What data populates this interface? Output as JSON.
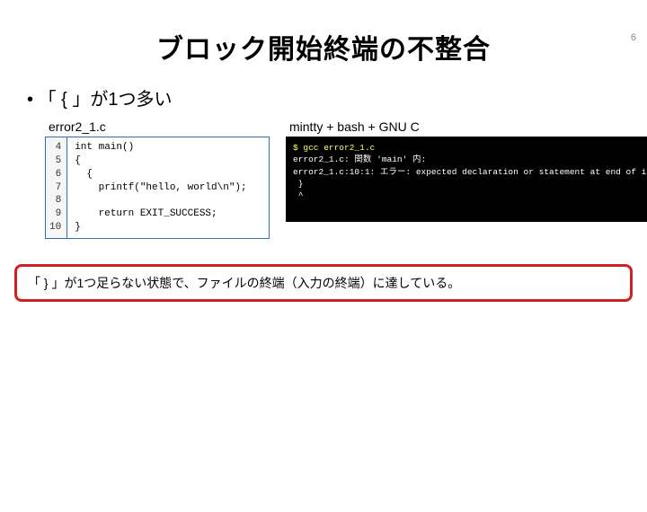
{
  "page_number": "6",
  "title": "ブロック開始終端の不整合",
  "bullet": "• 「 { 」が1つ多い",
  "left": {
    "label": "error2_1.c",
    "line_numbers": "4\n5\n6\n7\n8\n9\n10",
    "code": "int main()\n{\n  {\n    printf(\"hello, world\\n\");\n\n    return EXIT_SUCCESS;\n}"
  },
  "right": {
    "label": "mintty + bash + GNU C",
    "cmd": "$ gcc error2_1.c",
    "output": "error2_1.c: 関数 'main' 内:\nerror2_1.c:10:1: エラー: expected declaration or statement at end of input\n }\n ^"
  },
  "callout": "「 } 」が1つ足らない状態で、ファイルの終端（入力の終端）に達している。"
}
